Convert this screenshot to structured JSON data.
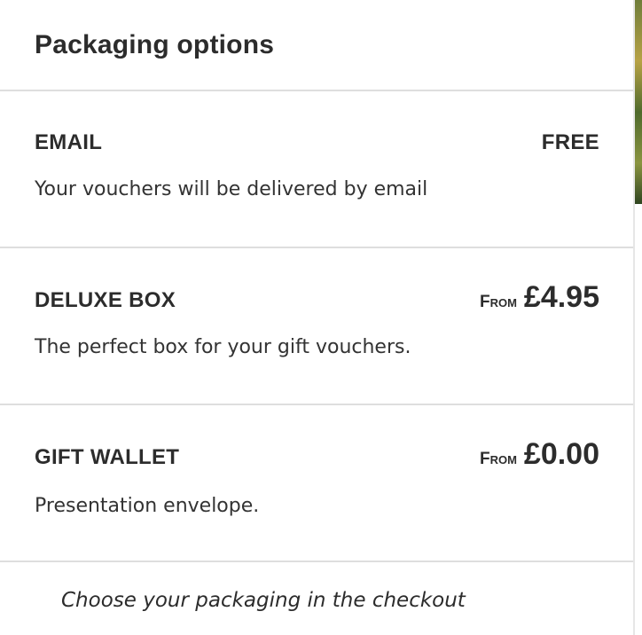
{
  "panel": {
    "title": "Packaging options"
  },
  "options": [
    {
      "name": "EMAIL",
      "price_prefix": "",
      "price": "FREE",
      "description": "Your vouchers will be delivered by email"
    },
    {
      "name": "DELUXE BOX",
      "price_prefix": "From",
      "price": "£4.95",
      "description": "The perfect box for your gift vouchers."
    },
    {
      "name": "GIFT WALLET",
      "price_prefix": "From",
      "price": "£0.00",
      "description": "Presentation envelope."
    }
  ],
  "footer": {
    "note": "Choose your packaging in the checkout"
  }
}
